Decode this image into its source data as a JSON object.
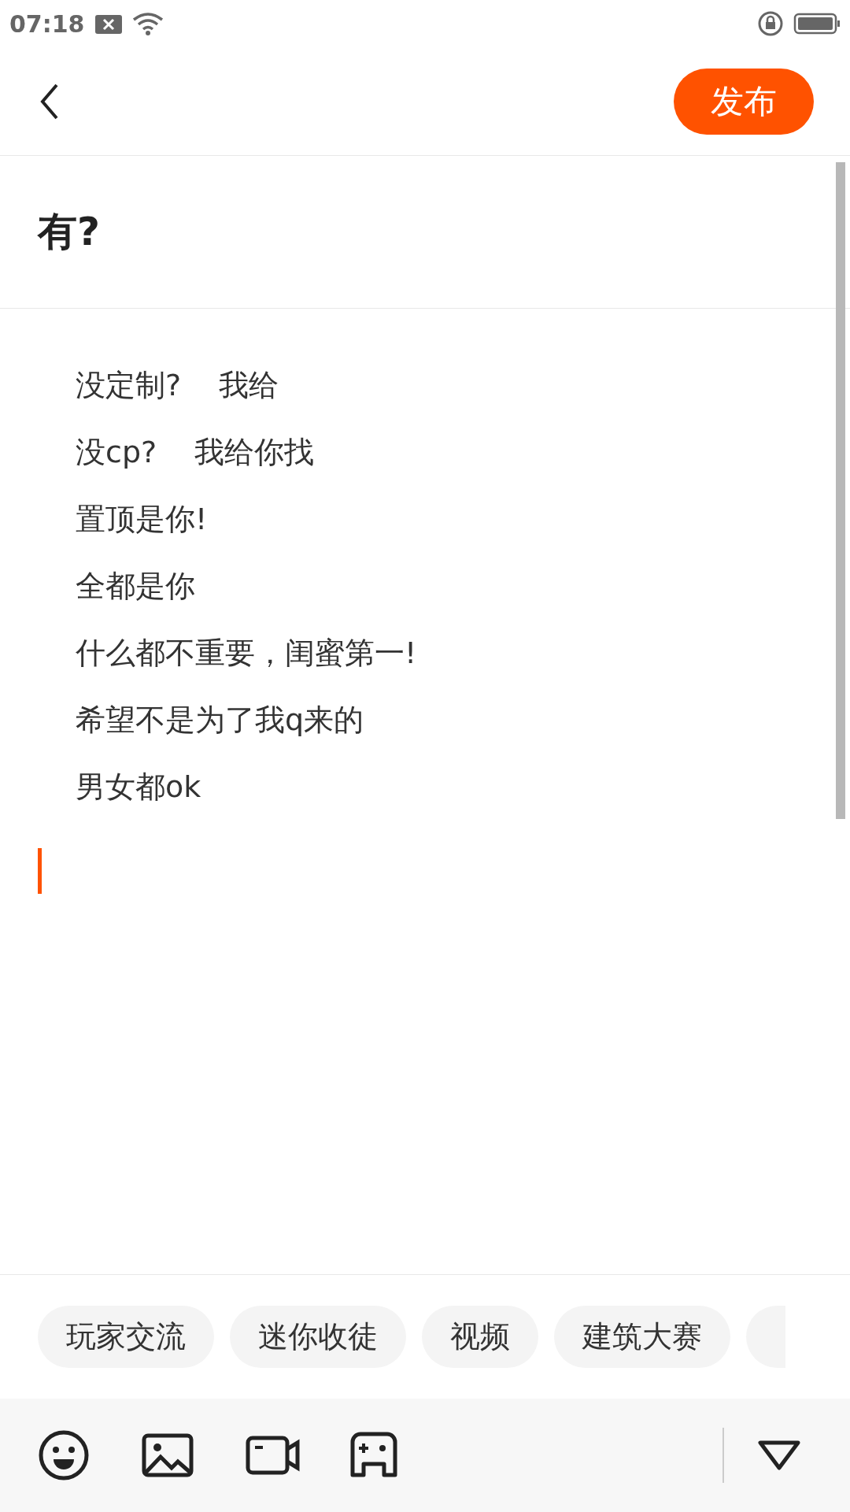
{
  "status_bar": {
    "time": "07:18"
  },
  "header": {
    "publish_button": "发布"
  },
  "post": {
    "title": "有?",
    "body_lines": [
      "没定制?    我给",
      "没cp?    我给你找",
      "置顶是你!",
      "全都是你",
      "什么都不重要，闺蜜第一!",
      "希望不是为了我q来的",
      "男女都ok"
    ]
  },
  "tags": [
    "玩家交流",
    "迷你收徒",
    "视频",
    "建筑大赛"
  ]
}
